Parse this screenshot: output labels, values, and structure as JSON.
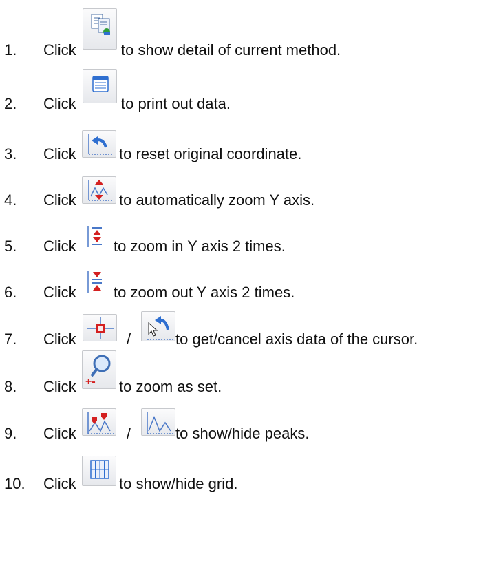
{
  "click_label": "Click",
  "separator": "/",
  "items": [
    {
      "num": "1.",
      "text": "to show detail of current method.",
      "icons": [
        "method-detail-icon"
      ]
    },
    {
      "num": "2.",
      "text": "to print out data.",
      "icons": [
        "print-icon"
      ]
    },
    {
      "num": "3.",
      "text": "to reset original coordinate.",
      "icons": [
        "reset-coordinate-icon"
      ]
    },
    {
      "num": "4.",
      "text": "to automatically zoom Y axis.",
      "icons": [
        "auto-zoom-y-icon"
      ]
    },
    {
      "num": "5.",
      "text": "to zoom in Y axis 2 times.",
      "icons": [
        "zoom-in-y-icon"
      ]
    },
    {
      "num": "6.",
      "text": "to zoom out Y axis 2 times.",
      "icons": [
        "zoom-out-y-icon"
      ]
    },
    {
      "num": "7.",
      "text": "to get/cancel axis data of the cursor.",
      "icons": [
        "crosshair-cursor-icon",
        "cancel-cursor-icon"
      ]
    },
    {
      "num": "8.",
      "text": "to zoom as set.",
      "icons": [
        "zoom-set-icon"
      ]
    },
    {
      "num": "9.",
      "text": "to show/hide peaks.",
      "icons": [
        "show-peaks-icon",
        "hide-peaks-icon"
      ]
    },
    {
      "num": "10.",
      "text": "to show/hide grid.",
      "icons": [
        "grid-icon"
      ]
    }
  ]
}
